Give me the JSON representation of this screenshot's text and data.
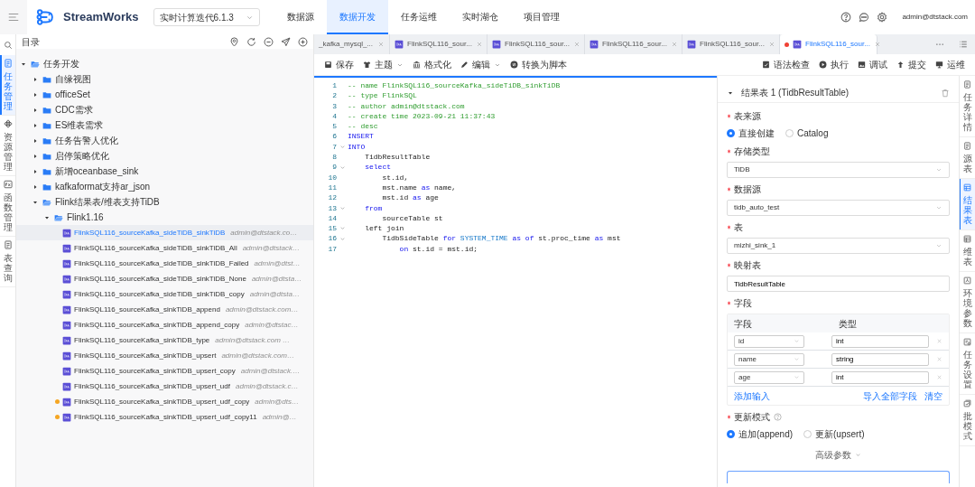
{
  "header": {
    "app_name": "StreamWorks",
    "project": "实时计算迭代6.1.3",
    "nav": [
      {
        "label": "数据源",
        "selected": false
      },
      {
        "label": "数据开发",
        "selected": true
      },
      {
        "label": "任务运维",
        "selected": false
      },
      {
        "label": "实时湖仓",
        "selected": false
      },
      {
        "label": "项目管理",
        "selected": false
      }
    ],
    "user": "admin@dtstack.com"
  },
  "left_rail": {
    "items": [
      {
        "label": "任务管理",
        "selected": true
      },
      {
        "label": "资源管理",
        "selected": false
      },
      {
        "label": "函数管理",
        "selected": false
      },
      {
        "label": "表查询",
        "selected": false
      }
    ]
  },
  "tree": {
    "title": "目录",
    "nodes": [
      {
        "kind": "folder",
        "label": "任务开发",
        "expanded": true,
        "children": [
          {
            "kind": "folder",
            "label": "自缘视图",
            "expanded": false
          },
          {
            "kind": "folder",
            "label": "officeSet",
            "expanded": false
          },
          {
            "kind": "folder",
            "label": "CDC需求",
            "expanded": false
          },
          {
            "kind": "folder",
            "label": "ES维表需求",
            "expanded": false
          },
          {
            "kind": "folder",
            "label": "任务告警人优化",
            "expanded": false
          },
          {
            "kind": "folder",
            "label": "启停策略优化",
            "expanded": false
          },
          {
            "kind": "folder",
            "label": "新增oceanbase_sink",
            "expanded": false
          },
          {
            "kind": "folder",
            "label": "kafkaformat支持ar_json",
            "expanded": false
          },
          {
            "kind": "folder",
            "label": "Flink结果表/维表支持TiDB",
            "expanded": true,
            "children": [
              {
                "kind": "folder",
                "label": "Flink1.16",
                "expanded": true,
                "children": [
                  {
                    "kind": "file",
                    "label": "FlinkSQL116_sourceKafka_sideTiDB_sinkTiDB",
                    "author": "admin@dtstack.co…",
                    "selected": true,
                    "modified": false
                  },
                  {
                    "kind": "file",
                    "label": "FlinkSQL116_sourceKafka_sideTiDB_sinkTiDB_All",
                    "author": "admin@dtstack…",
                    "selected": false,
                    "modified": false
                  },
                  {
                    "kind": "file",
                    "label": "FlinkSQL116_sourceKafka_sideTiDB_sinkTiDB_Failed",
                    "author": "admin@dtst…",
                    "selected": false,
                    "modified": false
                  },
                  {
                    "kind": "file",
                    "label": "FlinkSQL116_sourceKafka_sideTiDB_sinkTiDB_None",
                    "author": "admin@dtsta…",
                    "selected": false,
                    "modified": false
                  },
                  {
                    "kind": "file",
                    "label": "FlinkSQL116_sourceKafka_sideTiDB_sinkTiDB_copy",
                    "author": "admin@dtsta…",
                    "selected": false,
                    "modified": false
                  },
                  {
                    "kind": "file",
                    "label": "FlinkSQL116_sourceKafka_sinkTiDB_append",
                    "author": "admin@dtstack.com…",
                    "selected": false,
                    "modified": false
                  },
                  {
                    "kind": "file",
                    "label": "FlinkSQL116_sourceKafka_sinkTiDB_append_copy",
                    "author": "admin@dtstac…",
                    "selected": false,
                    "modified": false
                  },
                  {
                    "kind": "file",
                    "label": "FlinkSQL116_sourceKafka_sinkTiDB_type",
                    "author": "admin@dtstack.com …",
                    "selected": false,
                    "modified": false
                  },
                  {
                    "kind": "file",
                    "label": "FlinkSQL116_sourceKafka_sinkTiDB_upsert",
                    "author": "admin@dtstack.com…",
                    "selected": false,
                    "modified": false
                  },
                  {
                    "kind": "file",
                    "label": "FlinkSQL116_sourceKafka_sinkTiDB_upsert_copy",
                    "author": "admin@dtstack.…",
                    "selected": false,
                    "modified": false
                  },
                  {
                    "kind": "file",
                    "label": "FlinkSQL116_sourceKafka_sinkTiDB_upsert_udf",
                    "author": "admin@dtstack.c…",
                    "selected": false,
                    "modified": false
                  },
                  {
                    "kind": "file",
                    "label": "FlinkSQL116_sourceKafka_sinkTiDB_upsert_udf_copy",
                    "author": "admin@dts…",
                    "selected": false,
                    "modified": true
                  },
                  {
                    "kind": "file",
                    "label": "FlinkSQL116_sourceKafka_sinkTiDB_upsert_udf_copy11",
                    "author": "admin@…",
                    "selected": false,
                    "modified": true
                  }
                ]
              }
            ]
          }
        ]
      }
    ]
  },
  "editor": {
    "tabs": [
      {
        "label": "_kafka_mysql_...",
        "has_icon": false,
        "selected": false,
        "modified": false
      },
      {
        "label": "FlinkSQL116_sour...",
        "has_icon": true,
        "selected": false,
        "modified": false
      },
      {
        "label": "FlinkSQL116_sour...",
        "has_icon": true,
        "selected": false,
        "modified": false
      },
      {
        "label": "FlinkSQL116_sour...",
        "has_icon": true,
        "selected": false,
        "modified": false
      },
      {
        "label": "FlinkSQL116_sour...",
        "has_icon": true,
        "selected": false,
        "modified": false
      },
      {
        "label": "FlinkSQL116_sour...",
        "has_icon": true,
        "selected": true,
        "modified": true
      }
    ],
    "toolbar_left": [
      {
        "label": "保存",
        "dropdown": false
      },
      {
        "label": "主题",
        "dropdown": true
      },
      {
        "label": "格式化",
        "dropdown": false
      },
      {
        "label": "编辑",
        "dropdown": true
      },
      {
        "label": "转换为脚本",
        "dropdown": false
      }
    ],
    "toolbar_right": [
      {
        "label": "语法检查"
      },
      {
        "label": "执行"
      },
      {
        "label": "调试"
      },
      {
        "label": "提交"
      },
      {
        "label": "运维"
      }
    ],
    "lines": [
      {
        "number": "1",
        "foldable": false,
        "tokens": [
          {
            "kind": "comment",
            "text": "-- name FlinkSQL116_sourceKafka_sideTiDB_sinkTiDB"
          }
        ]
      },
      {
        "number": "2",
        "foldable": false,
        "tokens": [
          {
            "kind": "comment",
            "text": "-- type FlinkSQL"
          }
        ]
      },
      {
        "number": "3",
        "foldable": false,
        "tokens": [
          {
            "kind": "comment",
            "text": "-- author admin@dtstack.com"
          }
        ]
      },
      {
        "number": "4",
        "foldable": false,
        "tokens": [
          {
            "kind": "comment",
            "text": "-- create time 2023-09-21 11:37:43"
          }
        ]
      },
      {
        "number": "5",
        "foldable": false,
        "tokens": [
          {
            "kind": "comment",
            "text": "-- desc"
          }
        ]
      },
      {
        "number": "6",
        "foldable": false,
        "tokens": [
          {
            "kind": "keyword",
            "text": "INSERT"
          }
        ]
      },
      {
        "number": "7",
        "foldable": true,
        "tokens": [
          {
            "kind": "keyword",
            "text": "INTO"
          }
        ]
      },
      {
        "number": "8",
        "foldable": false,
        "tokens": [
          {
            "kind": "plain",
            "text": "    TidbResultTable"
          }
        ]
      },
      {
        "number": "9",
        "foldable": true,
        "tokens": [
          {
            "kind": "keyword",
            "text": "    select"
          }
        ]
      },
      {
        "number": "10",
        "foldable": false,
        "tokens": [
          {
            "kind": "plain",
            "text": "        st.id,"
          }
        ]
      },
      {
        "number": "11",
        "foldable": false,
        "tokens": [
          {
            "kind": "plain",
            "text": "        mst.name "
          },
          {
            "kind": "keyword",
            "text": "as"
          },
          {
            "kind": "plain",
            "text": " name,"
          }
        ]
      },
      {
        "number": "12",
        "foldable": false,
        "tokens": [
          {
            "kind": "plain",
            "text": "        mst.id "
          },
          {
            "kind": "keyword",
            "text": "as"
          },
          {
            "kind": "plain",
            "text": " age"
          }
        ]
      },
      {
        "number": "13",
        "foldable": true,
        "tokens": [
          {
            "kind": "keyword",
            "text": "    from"
          }
        ]
      },
      {
        "number": "14",
        "foldable": false,
        "tokens": [
          {
            "kind": "plain",
            "text": "        sourceTable st"
          }
        ]
      },
      {
        "number": "15",
        "foldable": true,
        "tokens": [
          {
            "kind": "plain",
            "text": "    left join"
          }
        ]
      },
      {
        "number": "16",
        "foldable": true,
        "tokens": [
          {
            "kind": "plain",
            "text": "        TidbSideTable "
          },
          {
            "kind": "keyword",
            "text": "for "
          },
          {
            "kind": "builtin",
            "text": "SYSTEM_TIME "
          },
          {
            "kind": "keyword",
            "text": "as of"
          },
          {
            "kind": "plain",
            "text": " st.proc_time "
          },
          {
            "kind": "keyword",
            "text": "as"
          },
          {
            "kind": "plain",
            "text": " mst"
          }
        ]
      },
      {
        "number": "17",
        "foldable": false,
        "tokens": [
          {
            "kind": "keyword",
            "text": "            on"
          },
          {
            "kind": "plain",
            "text": " st.id = mst.id;"
          }
        ]
      }
    ]
  },
  "result_panel": {
    "title": "结果表 1 (TidbResultTable)",
    "fields": [
      {
        "kind": "radio",
        "label": "表来源",
        "required": true,
        "help": false,
        "options": [
          {
            "label": "直接创建",
            "selected": true
          },
          {
            "label": "Catalog",
            "selected": false
          }
        ]
      },
      {
        "kind": "select",
        "label": "存储类型",
        "required": true,
        "help": false,
        "value": "TiDB"
      },
      {
        "kind": "select",
        "label": "数据源",
        "required": true,
        "help": false,
        "value": "tidb_auto_test"
      },
      {
        "kind": "select",
        "label": "表",
        "required": true,
        "help": false,
        "value": "mizhi_sink_1"
      },
      {
        "kind": "input",
        "label": "映射表",
        "required": true,
        "help": false,
        "value": "TidbResultTable"
      },
      {
        "kind": "table",
        "label": "字段",
        "required": true,
        "help": false,
        "columns": [
          "字段",
          "类型"
        ],
        "rows": [
          {
            "field": "id",
            "type": "int"
          },
          {
            "field": "name",
            "type": "string"
          },
          {
            "field": "age",
            "type": "int"
          }
        ],
        "add_action": "添加输入",
        "actions": [
          "导入全部字段",
          "清空"
        ]
      },
      {
        "kind": "radio",
        "label": "更新模式",
        "required": true,
        "help": true,
        "options": [
          {
            "label": "追加(append)",
            "selected": true
          },
          {
            "label": "更新(upsert)",
            "selected": false
          }
        ]
      }
    ],
    "advanced": "高级参数"
  },
  "right_rail": {
    "items": [
      {
        "label": "任务详情",
        "selected": false
      },
      {
        "label": "源表",
        "selected": false
      },
      {
        "label": "结果表",
        "selected": true
      },
      {
        "label": "维表",
        "selected": false
      },
      {
        "label": "环境参数",
        "selected": false
      },
      {
        "label": "任务设置",
        "selected": false
      },
      {
        "label": "批模式",
        "selected": false
      }
    ]
  }
}
